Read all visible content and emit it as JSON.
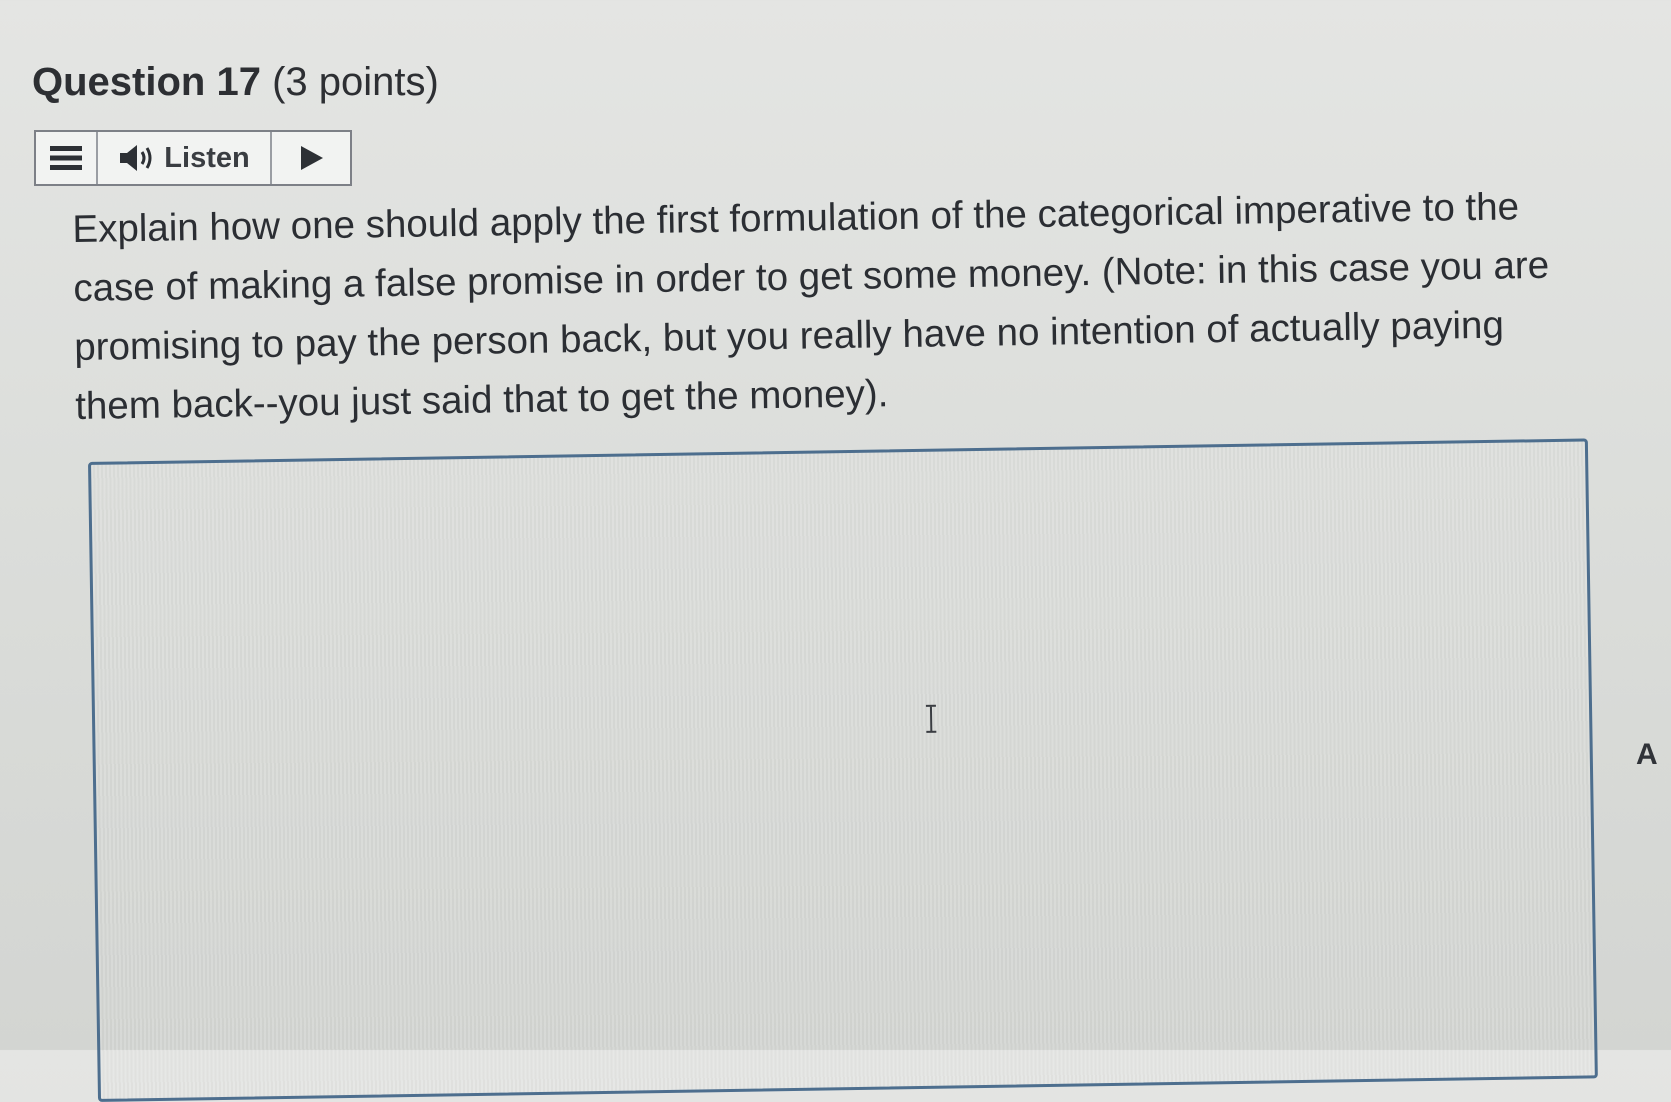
{
  "question": {
    "title": "Question 17",
    "points": "(3 points)",
    "prompt": "Explain how one should apply the first formulation of the categorical imperative to the case of making a false promise in order to get some money. (Note: in this case you are promising to pay the person back, but you really have no intention of actually paying them back--you just said that to get the money)."
  },
  "toolbar": {
    "listen_label": "Listen",
    "icons": [
      "menu-icon",
      "speaker-icon",
      "play-icon"
    ]
  },
  "answer": {
    "value": ""
  },
  "side": {
    "spellcheck_label": "A"
  }
}
